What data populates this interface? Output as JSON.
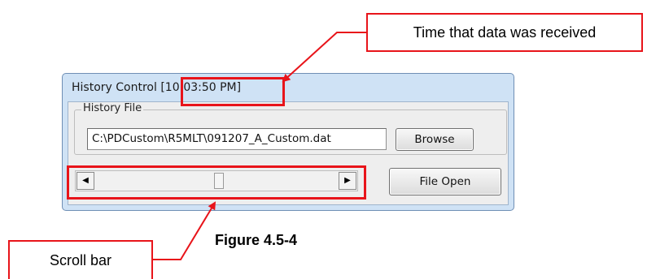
{
  "window": {
    "title": "History Control [",
    "time": "10:03:50 PM]"
  },
  "group": {
    "label": "History File",
    "path_value": "C:\\PDCustom\\R5MLT\\091207_A_Custom.dat"
  },
  "buttons": {
    "browse_label": "Browse",
    "file_open_label": "File Open"
  },
  "scrollbar": {
    "left_arrow_icon": "left-triangle-icon",
    "right_arrow_icon": "right-triangle-icon",
    "position_fraction": 0.5
  },
  "callouts": {
    "time_label": "Time that data was received",
    "scroll_label": "Scroll bar"
  },
  "caption": "Figure 4.5-4",
  "colors": {
    "annotation_red": "#e8141a",
    "titlebar_blue": "#cfe2f5"
  }
}
